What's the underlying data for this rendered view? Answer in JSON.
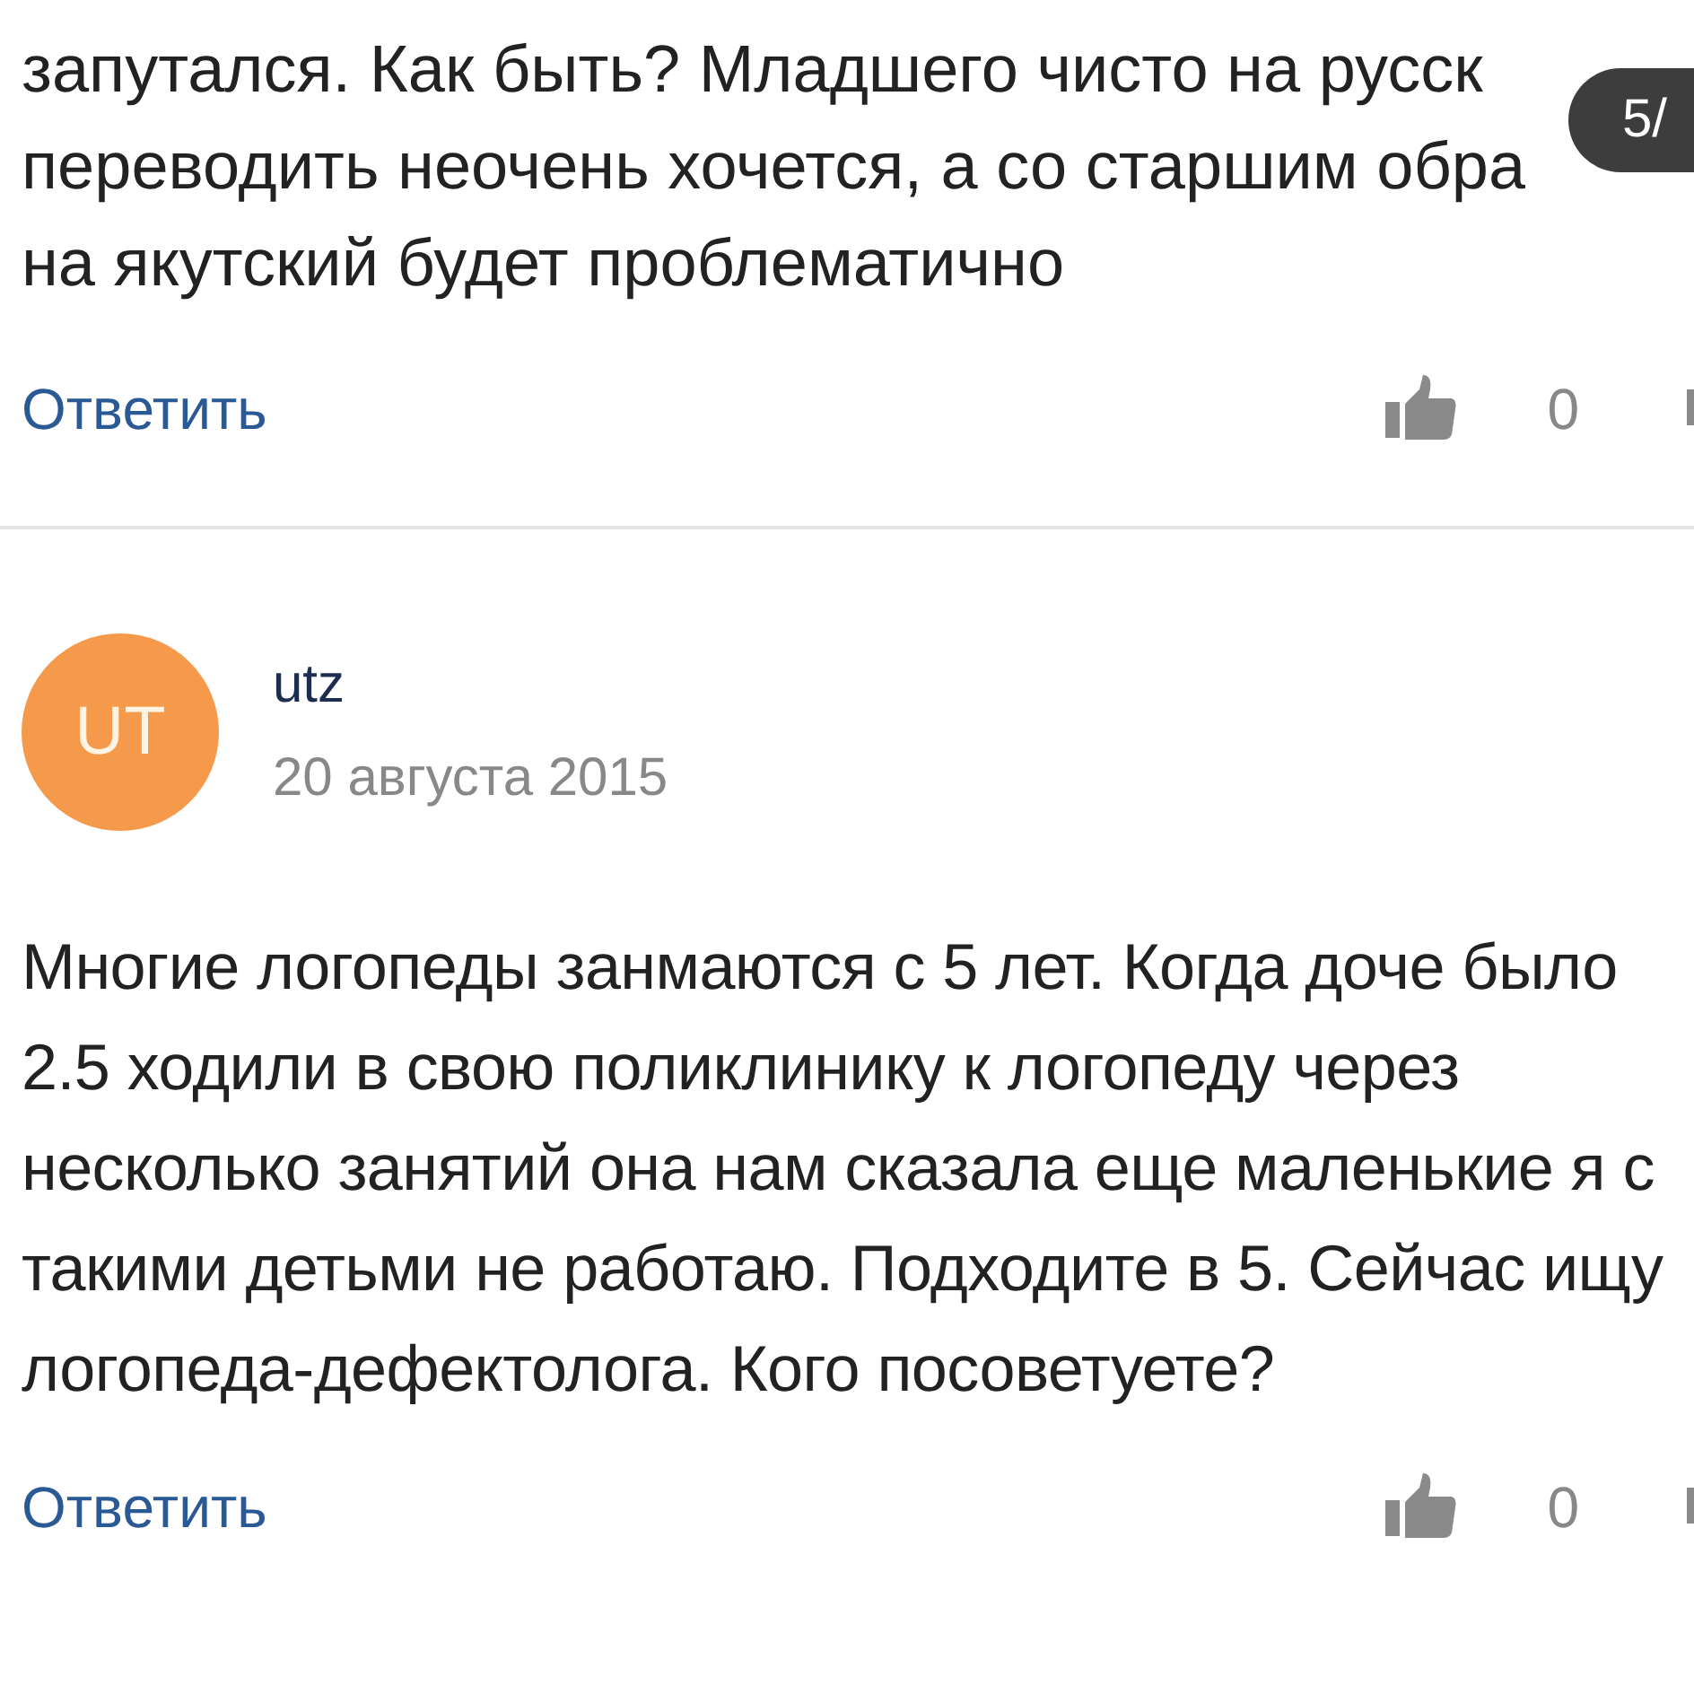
{
  "pager_badge": "5/",
  "comments": [
    {
      "kind": "cut",
      "lines": [
        "запутался. Как быть? Младшего чисто на русск",
        "переводить неочень хочется, а со старшим обра",
        "на якутский будет проблематично"
      ],
      "reply": "Ответить",
      "likes": "0"
    },
    {
      "kind": "full",
      "avatar": {
        "initials": "UT",
        "color": "#f59a4b"
      },
      "author": "utz",
      "date": "20 августа 2015",
      "text": "Многие логопеды занмаются с 5 лет. Когда доче было 2.5 ходили в свою поликлинику к логопеду через несколько занятий она нам сказала еще маленькие я с такими детьми не работаю. Подходите в 5. Сейчас ищу логопеда-дефектолога. Кого посоветуете?",
      "reply": "Ответить",
      "likes": "0"
    }
  ]
}
